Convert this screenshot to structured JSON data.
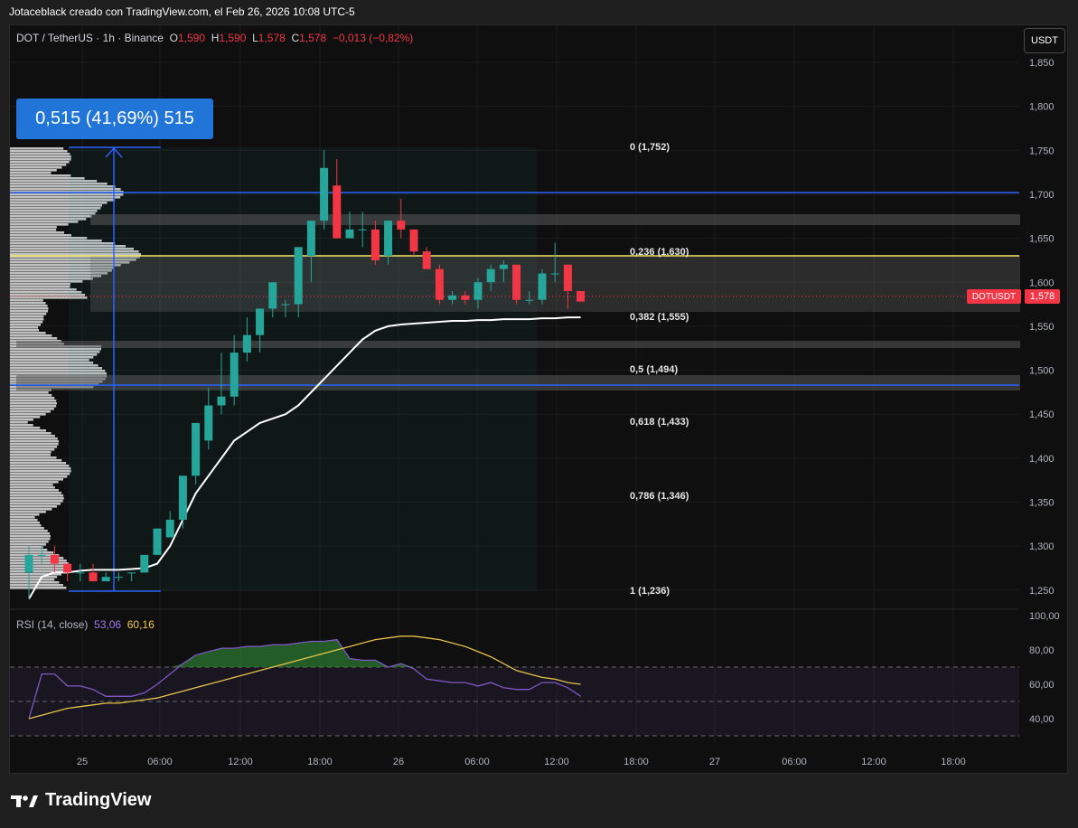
{
  "watermark": "Jotaceblack creado con TradingView.com, el Feb 26, 2026 10:08 UTC-5",
  "header": {
    "symbol": "DOT / TetherUS · 1h · Binance",
    "o_label": "O",
    "o": "1,590",
    "h_label": "H",
    "h": "1,590",
    "l_label": "L",
    "l": "1,578",
    "c_label": "C",
    "c": "1,578",
    "change": "−0,013 (−0,82%)"
  },
  "currency_button": "USDT",
  "measure_label": "0,515 (41,69%) 515",
  "rsi_header": {
    "label": "RSI (14, close)",
    "rsi": "53,06",
    "ma": "60,16"
  },
  "last_price": {
    "symbol": "DOTUSDT",
    "value": "1,578"
  },
  "brand": "TradingView",
  "colors": {
    "up": "#26a69a",
    "down": "#f23645",
    "rsi": "#7e57c2",
    "rsi_ma": "#e6c24a",
    "fib_236": "#f5e663",
    "blue_lines": "#2962ff"
  },
  "chart_data": {
    "type": "candlestick",
    "symbol": "DOT / TetherUS",
    "interval": "1h",
    "y_axis_ticks": [
      "1,850",
      "1,800",
      "1,750",
      "1,700",
      "1,650",
      "1,600",
      "1,550",
      "1,500",
      "1,450",
      "1,400",
      "1,350",
      "1,300",
      "1,250"
    ],
    "x_axis_ticks": [
      "25",
      "06:00",
      "12:00",
      "18:00",
      "26",
      "06:00",
      "12:00",
      "18:00",
      "27",
      "06:00",
      "12:00",
      "18:00"
    ],
    "rsi_axis_ticks": [
      "100,00",
      "80,00",
      "60,00",
      "40,00"
    ],
    "fib_levels": [
      {
        "label": "0 (1,752)",
        "value": 1.752
      },
      {
        "label": "0,236 (1,630)",
        "value": 1.63
      },
      {
        "label": "0,382 (1,555)",
        "value": 1.555
      },
      {
        "label": "0,5 (1,494)",
        "value": 1.494
      },
      {
        "label": "0,618 (1,433)",
        "value": 1.433
      },
      {
        "label": "0,786 (1,346)",
        "value": 1.346
      },
      {
        "label": "1 (1,236)",
        "value": 1.236
      }
    ],
    "candles": [
      [
        1.27,
        1.3,
        1.24,
        1.29
      ],
      [
        1.29,
        1.3,
        1.28,
        1.29
      ],
      [
        1.29,
        1.3,
        1.27,
        1.28
      ],
      [
        1.28,
        1.28,
        1.26,
        1.27
      ],
      [
        1.27,
        1.28,
        1.26,
        1.27
      ],
      [
        1.27,
        1.28,
        1.26,
        1.26
      ],
      [
        1.26,
        1.27,
        1.26,
        1.265
      ],
      [
        1.265,
        1.27,
        1.26,
        1.265
      ],
      [
        1.27,
        1.27,
        1.26,
        1.27
      ],
      [
        1.27,
        1.29,
        1.27,
        1.29
      ],
      [
        1.29,
        1.32,
        1.29,
        1.32
      ],
      [
        1.31,
        1.34,
        1.31,
        1.33
      ],
      [
        1.33,
        1.38,
        1.32,
        1.38
      ],
      [
        1.38,
        1.44,
        1.37,
        1.44
      ],
      [
        1.42,
        1.48,
        1.41,
        1.46
      ],
      [
        1.46,
        1.52,
        1.45,
        1.47
      ],
      [
        1.47,
        1.54,
        1.46,
        1.52
      ],
      [
        1.52,
        1.56,
        1.51,
        1.54
      ],
      [
        1.54,
        1.57,
        1.52,
        1.57
      ],
      [
        1.57,
        1.6,
        1.56,
        1.6
      ],
      [
        1.575,
        1.58,
        1.56,
        1.575
      ],
      [
        1.575,
        1.64,
        1.56,
        1.64
      ],
      [
        1.63,
        1.67,
        1.6,
        1.67
      ],
      [
        1.67,
        1.75,
        1.66,
        1.73
      ],
      [
        1.71,
        1.74,
        1.65,
        1.65
      ],
      [
        1.65,
        1.68,
        1.65,
        1.66
      ],
      [
        1.66,
        1.68,
        1.64,
        1.66
      ],
      [
        1.66,
        1.67,
        1.62,
        1.625
      ],
      [
        1.63,
        1.67,
        1.62,
        1.67
      ],
      [
        1.67,
        1.695,
        1.65,
        1.66
      ],
      [
        1.66,
        1.66,
        1.63,
        1.635
      ],
      [
        1.635,
        1.64,
        1.615,
        1.615
      ],
      [
        1.615,
        1.62,
        1.575,
        1.58
      ],
      [
        1.58,
        1.59,
        1.575,
        1.585
      ],
      [
        1.585,
        1.59,
        1.575,
        1.58
      ],
      [
        1.58,
        1.605,
        1.57,
        1.6
      ],
      [
        1.6,
        1.62,
        1.59,
        1.615
      ],
      [
        1.615,
        1.625,
        1.6,
        1.62
      ],
      [
        1.62,
        1.62,
        1.575,
        1.58
      ],
      [
        1.58,
        1.59,
        1.575,
        1.58
      ],
      [
        1.58,
        1.615,
        1.575,
        1.61
      ],
      [
        1.61,
        1.645,
        1.6,
        1.61
      ],
      [
        1.62,
        1.62,
        1.57,
        1.59
      ],
      [
        1.59,
        1.59,
        1.578,
        1.578
      ]
    ],
    "ema": [
      1.24,
      1.265,
      1.27,
      1.27,
      1.272,
      1.273,
      1.273,
      1.273,
      1.274,
      1.275,
      1.28,
      1.3,
      1.33,
      1.36,
      1.38,
      1.4,
      1.42,
      1.43,
      1.44,
      1.445,
      1.45,
      1.46,
      1.475,
      1.49,
      1.505,
      1.52,
      1.535,
      1.545,
      1.55,
      1.552,
      1.553,
      1.554,
      1.555,
      1.556,
      1.556,
      1.557,
      1.557,
      1.558,
      1.558,
      1.558,
      1.559,
      1.559,
      1.56,
      1.56
    ],
    "rsi": [
      40,
      66,
      66,
      59,
      59,
      57,
      53,
      53,
      53,
      55,
      60,
      66,
      72,
      77,
      79,
      81,
      81,
      82,
      82,
      83,
      83,
      84,
      85,
      85,
      86,
      75,
      74,
      74,
      70,
      72,
      69,
      63,
      62,
      61,
      61,
      59,
      61,
      58,
      57,
      57,
      61,
      61,
      58,
      53
    ],
    "rsi_ma": [
      40,
      42,
      44,
      46,
      47,
      48,
      49,
      49,
      50,
      51,
      52,
      54,
      56,
      58,
      60,
      62,
      64,
      66,
      68,
      70,
      72,
      74,
      76,
      78,
      80,
      82,
      84,
      86,
      87,
      88,
      88,
      87,
      86,
      84,
      82,
      79,
      76,
      72,
      68,
      66,
      64,
      63,
      61,
      60
    ],
    "rsi_band": [
      30,
      70
    ]
  }
}
